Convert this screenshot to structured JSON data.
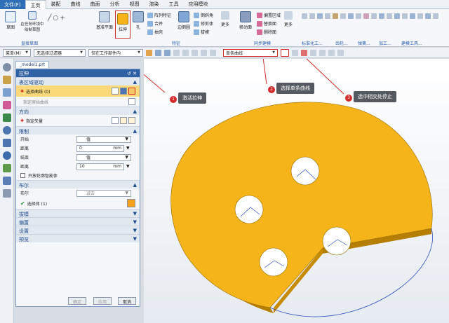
{
  "menubar": {
    "file": "文件(F)",
    "items": [
      "主页",
      "装配",
      "曲线",
      "曲面",
      "分析",
      "视图",
      "渲染",
      "工具",
      "应用模块"
    ],
    "active_index": 0
  },
  "ribbon": {
    "sketch": "草图",
    "sketch_in_task": "在任务环境中绘制草图",
    "group_direct_sketch": "直接草图",
    "datum_plane": "基准平面",
    "extrude": "拉伸",
    "hole": "孔",
    "array_feature": "阵列特征",
    "unite": "合并",
    "shell": "抽壳",
    "edge_blend": "边倒圆",
    "chamfer": "倒斜角",
    "trim_body": "修剪体",
    "draft": "拔模",
    "more1": "更多",
    "group_feature": "特征",
    "move_face": "移动面",
    "offset_region": "偏置区域",
    "replace_face": "替换面",
    "delete_face": "删除面",
    "more2": "更多",
    "group_sync": "同步建模",
    "group_std": "标准化工...",
    "group_gear": "齿轮...",
    "group_spring": "弹簧...",
    "group_machining": "加工...",
    "group_modeling_tools": "建模工具..."
  },
  "filterbar": {
    "menu": "菜单(M)",
    "filter": "无选择过滤器",
    "scope": "仅在工作部件内",
    "curve_rule": "单条曲线"
  },
  "tab": {
    "label": "_model1.prt"
  },
  "panel": {
    "title": "拉伸",
    "section_profile": "表区域驱动",
    "select_curve": "选择曲线 (0)",
    "draw_section": "指定原始曲线",
    "section_direction": "方向",
    "specify_vector": "指定矢量",
    "section_limits": "限制",
    "start": "开始",
    "start_type": "值",
    "distance1_label": "距离",
    "distance1_value": "0",
    "unit": "mm",
    "end": "结束",
    "end_type": "值",
    "distance2_label": "距离",
    "distance2_value": "10",
    "open_profile": "开放轮廓智能体",
    "section_boolean": "布尔",
    "boolean_label": "布尔",
    "boolean_value": "减去",
    "select_body": "选择体 (1)",
    "section_draft": "拔模",
    "section_offset": "偏置",
    "section_settings": "设置",
    "section_preview": "预览",
    "ok": "确定",
    "apply": "应用",
    "cancel": "取消"
  },
  "callouts": [
    {
      "num": "1",
      "text": "激活拉伸"
    },
    {
      "num": "2",
      "text": "选择单条曲线"
    },
    {
      "num": "3",
      "text": "选中相交处停止"
    }
  ],
  "colors": {
    "part": "#f5b51a",
    "accent": "#2f62a5",
    "highlight": "#f9d978",
    "callout_red": "#d32b2b"
  }
}
